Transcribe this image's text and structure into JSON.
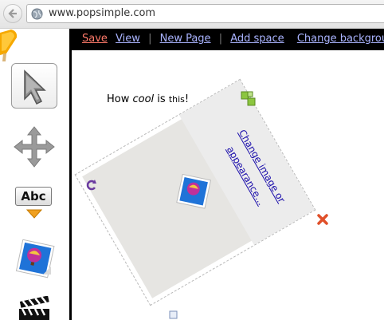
{
  "browser": {
    "url": "www.popsimple.com"
  },
  "menu": {
    "save": "Save",
    "view": "View",
    "separator": "|",
    "new_page": "New Page",
    "add_space": "Add space",
    "change_background": "Change backgrou"
  },
  "canvas": {
    "text_before": "How ",
    "text_em": "cool",
    "text_mid": " is ",
    "text_small": "this",
    "text_end": "!",
    "widget_link_line1": "Change image or",
    "widget_link_line2": "appearance..."
  },
  "tools": [
    {
      "name": "select-tool",
      "icon": "arrow-pointer-icon",
      "selected": true
    },
    {
      "name": "move-tool",
      "icon": "move-arrows-icon"
    },
    {
      "name": "text-tool",
      "icon": "abc-text-icon",
      "label": "Abc"
    },
    {
      "name": "image-tool",
      "icon": "balloon-image-icon"
    },
    {
      "name": "video-tool",
      "icon": "clapperboard-icon"
    }
  ],
  "colors": {
    "menu_bg": "#000000",
    "link": "#aab4ff",
    "save_link": "#ff7a6a",
    "widget_bg": "#e6e5e2"
  }
}
